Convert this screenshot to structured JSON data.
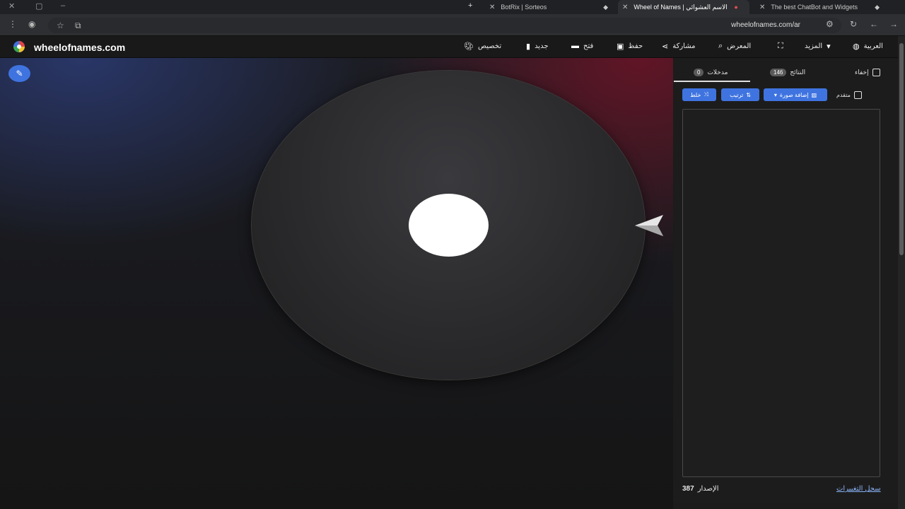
{
  "browser": {
    "tabs": [
      {
        "label": "BotRix | Sorteos",
        "active": false
      },
      {
        "label": "Wheel of Names | عجلة الاسم العشوائي",
        "active": true
      },
      {
        "label": "The best ChatBot and Widgets",
        "active": false
      }
    ],
    "url": "wheelofnames.com/ar"
  },
  "app": {
    "logo_text": "wheelofnames.com",
    "menu": {
      "customize": "تخصيص",
      "new": "جديد",
      "open": "فتح",
      "save": "حفظ",
      "share": "مشاركة",
      "gallery": "المعرض",
      "more": "المزيد",
      "language": "العربية"
    }
  },
  "panel": {
    "tab_entries_label": "مدخلات",
    "tab_entries_count": "0",
    "tab_results_label": "النتائج",
    "tab_results_count": "146",
    "hide_label": "إخفاء",
    "shuffle_label": "خلط",
    "sort_label": "ترتيب",
    "add_image_label": "إضافة صورة",
    "advanced_label": "متقدم",
    "version_label": "الإصدار",
    "version_number": "387",
    "changelog_link": "سجل التغييرات"
  },
  "colors": {
    "accent": "#3f74e0",
    "panel_bg": "#1c1c1c",
    "link": "#8ab4f8"
  }
}
